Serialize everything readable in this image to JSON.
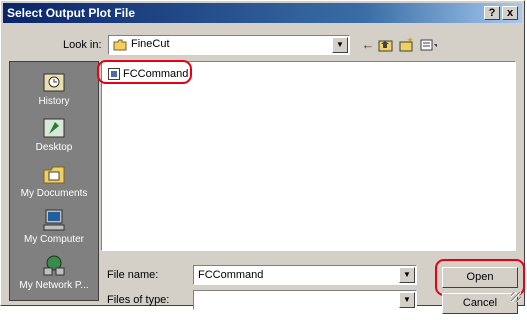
{
  "window": {
    "title": "Select Output Plot File",
    "help_label": "?",
    "close_label": "x"
  },
  "lookin": {
    "label": "Look in:",
    "value": "FineCut",
    "icon": "folder-icon"
  },
  "toolbar": {
    "back_icon": "←",
    "up_icon": "up-folder-icon",
    "new_folder_icon": "new-folder-icon",
    "view_icon": "view-menu-icon"
  },
  "places": [
    {
      "label": "History",
      "icon": "history-icon"
    },
    {
      "label": "Desktop",
      "icon": "desktop-icon"
    },
    {
      "label": "My Documents",
      "icon": "my-documents-icon"
    },
    {
      "label": "My Computer",
      "icon": "my-computer-icon"
    },
    {
      "label": "My Network P...",
      "icon": "network-places-icon"
    }
  ],
  "files": [
    {
      "name": "FCCommand"
    }
  ],
  "filename": {
    "label": "File name:",
    "value": "FCCommand"
  },
  "filetype": {
    "label": "Files of type:",
    "value": ""
  },
  "buttons": {
    "open": "Open",
    "cancel": "Cancel"
  },
  "colors": {
    "highlight": "#e60012",
    "titlebar": "#0a246a",
    "dialog": "#d4d0c8"
  }
}
